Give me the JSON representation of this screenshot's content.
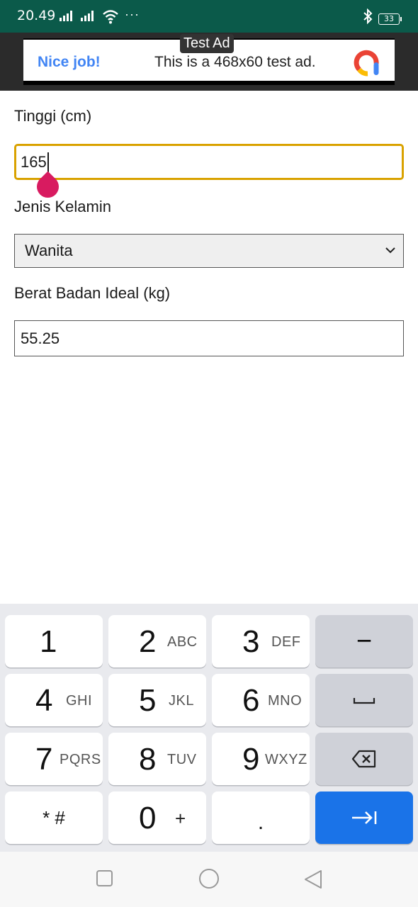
{
  "status_bar": {
    "time": "20.49",
    "dots": "···",
    "battery": "33"
  },
  "ad": {
    "tag": "Test Ad",
    "headline": "Nice job!",
    "body": "This is a 468x60 test ad.",
    "logo_icon": "admob-logo"
  },
  "form": {
    "height_label": "Tinggi (cm)",
    "height_value": "165",
    "gender_label": "Jenis Kelamin",
    "gender_value": "Wanita",
    "ideal_label": "Berat Badan Ideal (kg)",
    "ideal_value": "55.25"
  },
  "keyboard": {
    "rows": [
      [
        {
          "d": "1",
          "l": ""
        },
        {
          "d": "2",
          "l": "ABC"
        },
        {
          "d": "3",
          "l": "DEF"
        }
      ],
      [
        {
          "d": "4",
          "l": "GHI"
        },
        {
          "d": "5",
          "l": "JKL"
        },
        {
          "d": "6",
          "l": "MNO"
        }
      ],
      [
        {
          "d": "7",
          "l": "PQRS"
        },
        {
          "d": "8",
          "l": "TUV"
        },
        {
          "d": "9",
          "l": "WXYZ"
        }
      ]
    ],
    "star_hash": "* #",
    "zero": "0",
    "plus": "+",
    "dot": ".",
    "minus": "−",
    "space_icon": "space-icon",
    "backspace_icon": "backspace-icon",
    "enter_icon": "next-field-icon"
  },
  "colors": {
    "status_bar": "#0b5a4a",
    "focus_border": "#d9a200",
    "accent_enter": "#1a73e8",
    "caret_drop": "#d81b60"
  }
}
